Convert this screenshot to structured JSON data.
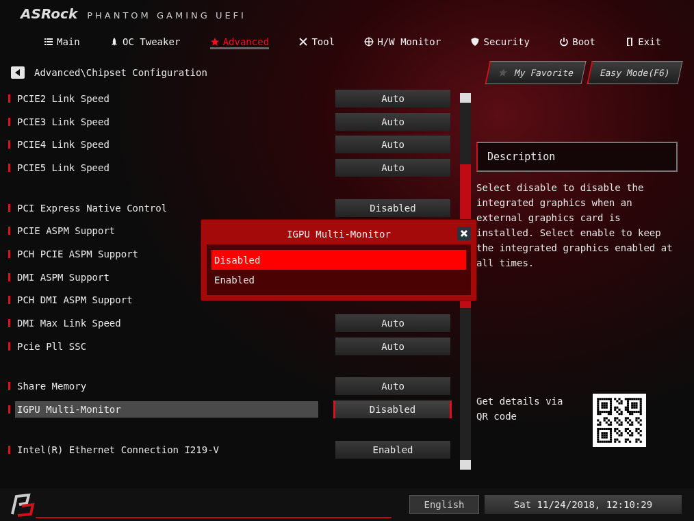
{
  "brand": {
    "logo": "ASRock",
    "subtitle": "PHANTOM GAMING UEFI"
  },
  "tabs": [
    {
      "label": "Main",
      "selected": false
    },
    {
      "label": "OC Tweaker",
      "selected": false
    },
    {
      "label": "Advanced",
      "selected": true
    },
    {
      "label": "Tool",
      "selected": false
    },
    {
      "label": "H/W Monitor",
      "selected": false
    },
    {
      "label": "Security",
      "selected": false
    },
    {
      "label": "Boot",
      "selected": false
    },
    {
      "label": "Exit",
      "selected": false
    }
  ],
  "breadcrumb": "Advanced\\Chipset Configuration",
  "top_buttons": [
    "My Favorite",
    "Easy Mode(F6)"
  ],
  "settings": [
    {
      "rows": [
        {
          "label": "PCIE2 Link Speed",
          "value": "Auto",
          "selected": false
        },
        {
          "label": "PCIE3 Link Speed",
          "value": "Auto",
          "selected": false
        },
        {
          "label": "PCIE4 Link Speed",
          "value": "Auto",
          "selected": false
        },
        {
          "label": "PCIE5 Link Speed",
          "value": "Auto",
          "selected": false
        }
      ]
    },
    {
      "rows": [
        {
          "label": "PCI Express Native Control",
          "value": "Disabled",
          "selected": false
        },
        {
          "label": "PCIE ASPM Support",
          "selected": false
        },
        {
          "label": "PCH PCIE ASPM Support",
          "selected": false
        },
        {
          "label": "DMI ASPM Support",
          "selected": false
        },
        {
          "label": "PCH DMI ASPM Support",
          "selected": false
        },
        {
          "label": "DMI Max Link Speed",
          "value": "Auto",
          "selected": false
        },
        {
          "label": "Pcie Pll SSC",
          "value": "Auto",
          "selected": false
        }
      ]
    },
    {
      "rows": [
        {
          "label": "Share Memory",
          "value": "Auto",
          "selected": false
        },
        {
          "label": "IGPU Multi-Monitor",
          "value": "Disabled",
          "selected": true
        }
      ]
    },
    {
      "rows": [
        {
          "label": "Intel(R) Ethernet Connection I219-V",
          "value": "Enabled",
          "selected": false
        }
      ]
    }
  ],
  "dialog": {
    "title": "IGPU Multi-Monitor",
    "options": [
      {
        "label": "Disabled",
        "selected": true
      },
      {
        "label": "Enabled",
        "selected": false
      }
    ]
  },
  "description": {
    "title": "Description",
    "text": "Select disable to disable the integrated graphics when an external graphics card is installed. Select enable to keep the integrated graphics enabled at all times."
  },
  "qr": {
    "text": "Get details via QR code"
  },
  "status_bar": {
    "language": "English",
    "datetime": "Sat 11/24/2018, 12:10:29"
  }
}
